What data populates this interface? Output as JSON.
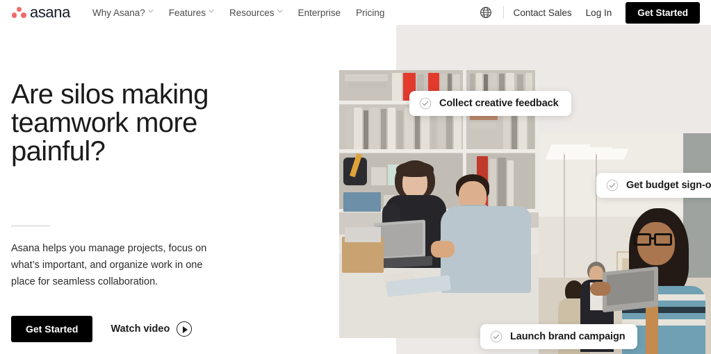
{
  "header": {
    "logo": {
      "name": "asana",
      "icon": "asana-dots-logo",
      "dot_color": "#f06a6a"
    },
    "nav": [
      {
        "label": "Why Asana?",
        "has_dropdown": true
      },
      {
        "label": "Features",
        "has_dropdown": true
      },
      {
        "label": "Resources",
        "has_dropdown": true
      },
      {
        "label": "Enterprise",
        "has_dropdown": false
      },
      {
        "label": "Pricing",
        "has_dropdown": false
      }
    ],
    "right": {
      "globe_icon": "globe-icon",
      "contact_sales": "Contact Sales",
      "log_in": "Log In",
      "get_started": "Get Started"
    }
  },
  "hero": {
    "headline": "Are silos making teamwork more painful?",
    "body": "Asana helps you manage projects, focus on what’s important, and organize work in one place for seamless collaboration.",
    "primary_cta": "Get Started",
    "secondary_cta": "Watch video",
    "secondary_cta_icon": "play-icon"
  },
  "cards": [
    {
      "label": "Collect creative feedback",
      "icon": "check-circle-icon"
    },
    {
      "label": "Get budget sign-off",
      "icon": "check-circle-icon"
    },
    {
      "label": "Launch brand campaign",
      "icon": "check-circle-icon"
    }
  ],
  "colors": {
    "brand_coral": "#f06a6a",
    "button_dark": "#000000",
    "panel_beige": "#ece9e7",
    "text_primary": "#1b1b1b",
    "text_nav": "#4b4b4b"
  }
}
